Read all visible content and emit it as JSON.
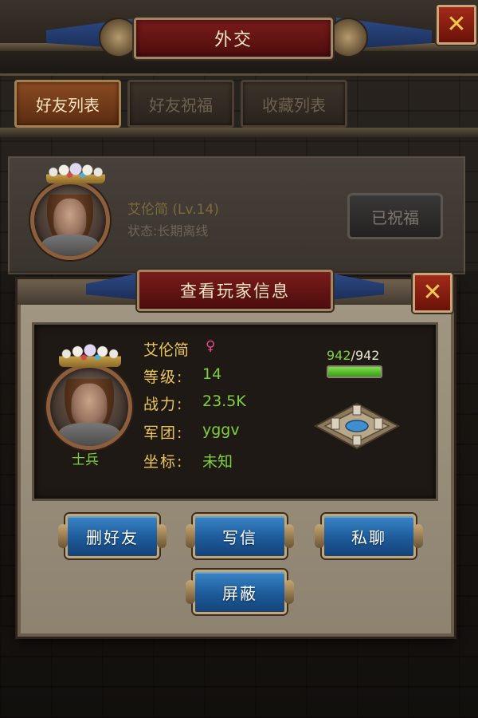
{
  "header": {
    "title": "外交",
    "close_glyph": "✕"
  },
  "tabs": [
    {
      "label": "好友列表",
      "active": true
    },
    {
      "label": "好友祝福",
      "active": false
    },
    {
      "label": "收藏列表",
      "active": false
    }
  ],
  "friend": {
    "name": "艾伦简 (Lv.14)",
    "status": "状态:长期离线",
    "blessed_label": "已祝福"
  },
  "modal": {
    "title": "查看玩家信息",
    "close_glyph": "✕",
    "player_name": "艾伦简",
    "gender_glyph": "♀",
    "rank": "士兵",
    "rows": [
      {
        "label": "等级:",
        "value": "14"
      },
      {
        "label": "战力:",
        "value": "23.5K"
      },
      {
        "label": "军团:",
        "value": "yggv"
      },
      {
        "label": "坐标:",
        "value": "未知"
      }
    ],
    "hp_current": "942",
    "hp_sep_max": "/942",
    "hp_fraction": 1.0,
    "buttons": {
      "delete_friend": "删好友",
      "write_letter": "写信",
      "private_chat": "私聊",
      "block": "屏蔽"
    }
  },
  "colors": {
    "accent_gold": "#e7c55a",
    "value_green": "#7fd13a",
    "title_red": "#7a1b1b",
    "button_blue": "#1d5a99"
  }
}
